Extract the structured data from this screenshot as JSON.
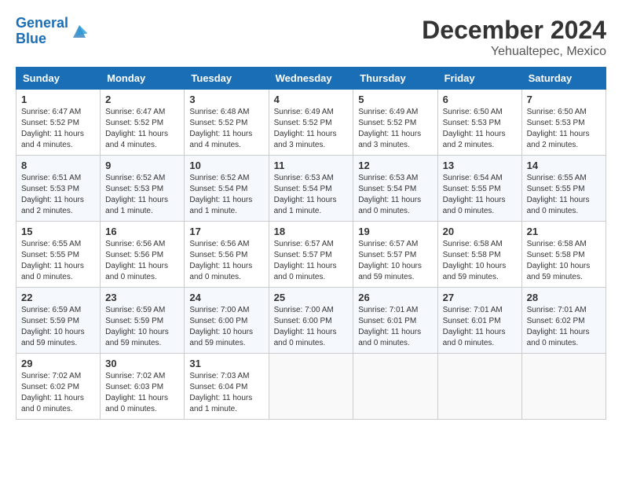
{
  "header": {
    "logo_line1": "General",
    "logo_line2": "Blue",
    "month_title": "December 2024",
    "location": "Yehualtepec, Mexico"
  },
  "weekdays": [
    "Sunday",
    "Monday",
    "Tuesday",
    "Wednesday",
    "Thursday",
    "Friday",
    "Saturday"
  ],
  "weeks": [
    [
      {
        "day": "1",
        "sunrise": "6:47 AM",
        "sunset": "5:52 PM",
        "daylight": "11 hours and 4 minutes."
      },
      {
        "day": "2",
        "sunrise": "6:47 AM",
        "sunset": "5:52 PM",
        "daylight": "11 hours and 4 minutes."
      },
      {
        "day": "3",
        "sunrise": "6:48 AM",
        "sunset": "5:52 PM",
        "daylight": "11 hours and 4 minutes."
      },
      {
        "day": "4",
        "sunrise": "6:49 AM",
        "sunset": "5:52 PM",
        "daylight": "11 hours and 3 minutes."
      },
      {
        "day": "5",
        "sunrise": "6:49 AM",
        "sunset": "5:52 PM",
        "daylight": "11 hours and 3 minutes."
      },
      {
        "day": "6",
        "sunrise": "6:50 AM",
        "sunset": "5:53 PM",
        "daylight": "11 hours and 2 minutes."
      },
      {
        "day": "7",
        "sunrise": "6:50 AM",
        "sunset": "5:53 PM",
        "daylight": "11 hours and 2 minutes."
      }
    ],
    [
      {
        "day": "8",
        "sunrise": "6:51 AM",
        "sunset": "5:53 PM",
        "daylight": "11 hours and 2 minutes."
      },
      {
        "day": "9",
        "sunrise": "6:52 AM",
        "sunset": "5:53 PM",
        "daylight": "11 hours and 1 minute."
      },
      {
        "day": "10",
        "sunrise": "6:52 AM",
        "sunset": "5:54 PM",
        "daylight": "11 hours and 1 minute."
      },
      {
        "day": "11",
        "sunrise": "6:53 AM",
        "sunset": "5:54 PM",
        "daylight": "11 hours and 1 minute."
      },
      {
        "day": "12",
        "sunrise": "6:53 AM",
        "sunset": "5:54 PM",
        "daylight": "11 hours and 0 minutes."
      },
      {
        "day": "13",
        "sunrise": "6:54 AM",
        "sunset": "5:55 PM",
        "daylight": "11 hours and 0 minutes."
      },
      {
        "day": "14",
        "sunrise": "6:55 AM",
        "sunset": "5:55 PM",
        "daylight": "11 hours and 0 minutes."
      }
    ],
    [
      {
        "day": "15",
        "sunrise": "6:55 AM",
        "sunset": "5:55 PM",
        "daylight": "11 hours and 0 minutes."
      },
      {
        "day": "16",
        "sunrise": "6:56 AM",
        "sunset": "5:56 PM",
        "daylight": "11 hours and 0 minutes."
      },
      {
        "day": "17",
        "sunrise": "6:56 AM",
        "sunset": "5:56 PM",
        "daylight": "11 hours and 0 minutes."
      },
      {
        "day": "18",
        "sunrise": "6:57 AM",
        "sunset": "5:57 PM",
        "daylight": "11 hours and 0 minutes."
      },
      {
        "day": "19",
        "sunrise": "6:57 AM",
        "sunset": "5:57 PM",
        "daylight": "10 hours and 59 minutes."
      },
      {
        "day": "20",
        "sunrise": "6:58 AM",
        "sunset": "5:58 PM",
        "daylight": "10 hours and 59 minutes."
      },
      {
        "day": "21",
        "sunrise": "6:58 AM",
        "sunset": "5:58 PM",
        "daylight": "10 hours and 59 minutes."
      }
    ],
    [
      {
        "day": "22",
        "sunrise": "6:59 AM",
        "sunset": "5:59 PM",
        "daylight": "10 hours and 59 minutes."
      },
      {
        "day": "23",
        "sunrise": "6:59 AM",
        "sunset": "5:59 PM",
        "daylight": "10 hours and 59 minutes."
      },
      {
        "day": "24",
        "sunrise": "7:00 AM",
        "sunset": "6:00 PM",
        "daylight": "10 hours and 59 minutes."
      },
      {
        "day": "25",
        "sunrise": "7:00 AM",
        "sunset": "6:00 PM",
        "daylight": "11 hours and 0 minutes."
      },
      {
        "day": "26",
        "sunrise": "7:01 AM",
        "sunset": "6:01 PM",
        "daylight": "11 hours and 0 minutes."
      },
      {
        "day": "27",
        "sunrise": "7:01 AM",
        "sunset": "6:01 PM",
        "daylight": "11 hours and 0 minutes."
      },
      {
        "day": "28",
        "sunrise": "7:01 AM",
        "sunset": "6:02 PM",
        "daylight": "11 hours and 0 minutes."
      }
    ],
    [
      {
        "day": "29",
        "sunrise": "7:02 AM",
        "sunset": "6:02 PM",
        "daylight": "11 hours and 0 minutes."
      },
      {
        "day": "30",
        "sunrise": "7:02 AM",
        "sunset": "6:03 PM",
        "daylight": "11 hours and 0 minutes."
      },
      {
        "day": "31",
        "sunrise": "7:03 AM",
        "sunset": "6:04 PM",
        "daylight": "11 hours and 1 minute."
      },
      null,
      null,
      null,
      null
    ]
  ]
}
